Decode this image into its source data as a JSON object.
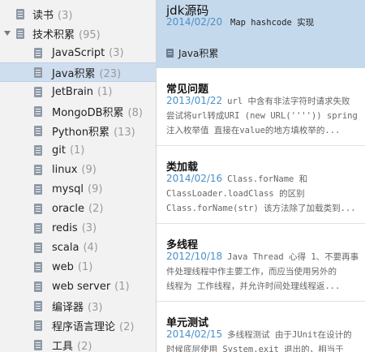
{
  "sidebar": {
    "items": [
      {
        "label": "读书",
        "count": "(3)",
        "level": 0
      },
      {
        "label": "技术积累",
        "count": "(95)",
        "level": 0,
        "expanded": true
      },
      {
        "label": "JavaScript",
        "count": "(3)",
        "level": 1
      },
      {
        "label": "Java积累",
        "count": "(23)",
        "level": 1,
        "selected": true
      },
      {
        "label": "JetBrain",
        "count": "(1)",
        "level": 1
      },
      {
        "label": "MongoDB积累",
        "count": "(8)",
        "level": 1
      },
      {
        "label": "Python积累",
        "count": "(13)",
        "level": 1
      },
      {
        "label": "git",
        "count": "(1)",
        "level": 1
      },
      {
        "label": "linux",
        "count": "(9)",
        "level": 1
      },
      {
        "label": "mysql",
        "count": "(9)",
        "level": 1
      },
      {
        "label": "oracle",
        "count": "(2)",
        "level": 1
      },
      {
        "label": "redis",
        "count": "(3)",
        "level": 1
      },
      {
        "label": "scala",
        "count": "(4)",
        "level": 1
      },
      {
        "label": "web",
        "count": "(1)",
        "level": 1
      },
      {
        "label": "web server",
        "count": "(1)",
        "level": 1
      },
      {
        "label": "编译器",
        "count": "(3)",
        "level": 1
      },
      {
        "label": "程序语言理论",
        "count": "(2)",
        "level": 1
      },
      {
        "label": "工具",
        "count": "(2)",
        "level": 1
      }
    ]
  },
  "header": {
    "title": "jdk源码",
    "date": "2014/02/20",
    "snippet": "Map hashcode 实现",
    "notebook": "Java积累"
  },
  "notes": [
    {
      "title": "常见问题",
      "date": "2013/01/22",
      "line1": "url 中含有非法字符时请求失败",
      "line2": "尝试将url转成URI (new URL('''')) spring",
      "line3": "注入枚举值 直接在value的地方填枚举的..."
    },
    {
      "title": "类加载",
      "date": "2014/02/16",
      "line1": "Class.forName 和",
      "line2": "ClassLoader.loadClass 的区别",
      "line3": "Class.forName(str) 该方法除了加载类到..."
    },
    {
      "title": "多线程",
      "date": "2012/10/18",
      "line1": "Java Thread 心得 1、不要再事",
      "line2": "件处理线程中作主要工作，而应当使用另外的",
      "line3": "线程为 工作线程，并允许时间处理线程返..."
    },
    {
      "title": "单元测试",
      "date": "2014/02/15",
      "line1": "多线程测试 由于JUnit在设计的",
      "line2": "时候底层使用 System.exit 退出的，相当于",
      "line3": ""
    }
  ],
  "colors": {
    "selected_bg": "#cfdeef",
    "header_bg": "#c5d9ec",
    "date": "#4a90c8",
    "icon": "#8e9aa6"
  }
}
